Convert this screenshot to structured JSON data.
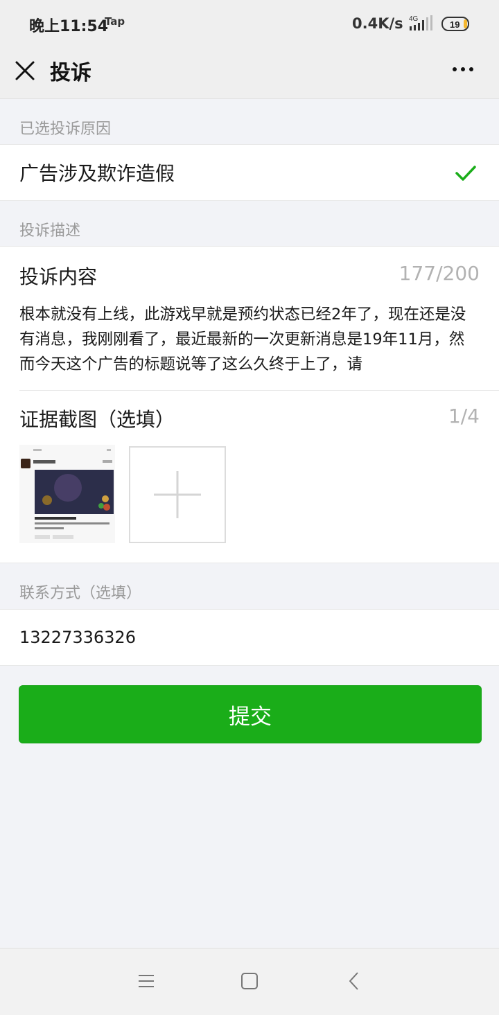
{
  "status_bar": {
    "time": "晚上11:54",
    "app_badge": "Tap",
    "net_speed": "0.4K/s",
    "network_type": "4G",
    "battery": "19"
  },
  "header": {
    "title": "投诉",
    "close_icon": "close-icon",
    "more_icon": "more-icon"
  },
  "reason_section": {
    "label": "已选投诉原因",
    "selected_reason": "广告涉及欺诈造假"
  },
  "description_section": {
    "label": "投诉描述",
    "content_title": "投诉内容",
    "content_count": "177/200",
    "content_text": "根本就没有上线，此游戏早就是预约状态已经2年了，现在还是没有消息，我刚刚看了，最近最新的一次更新消息是19年11月，然而今天这个广告的标题说等了这么久终于上了，请",
    "evidence_title": "证据截图（选填）",
    "evidence_count": "1/4"
  },
  "contact_section": {
    "label": "联系方式（选填）",
    "value": "13227336326"
  },
  "submit_label": "提交",
  "colors": {
    "accent": "#1aad19",
    "background": "#f2f3f7"
  }
}
